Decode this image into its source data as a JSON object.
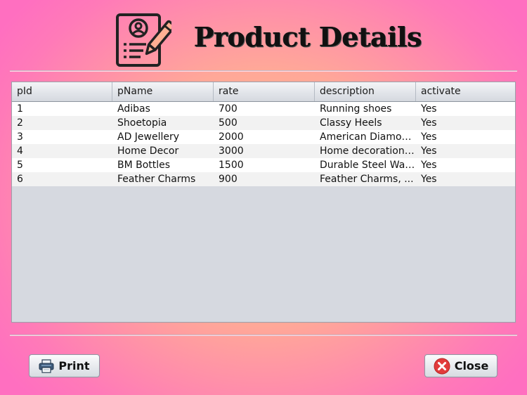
{
  "header": {
    "title": "Product Details",
    "icon": "product-details-icon"
  },
  "table": {
    "columns": [
      "pId",
      "pName",
      "rate",
      "description",
      "activate"
    ],
    "rows": [
      [
        "1",
        "Adibas",
        "700",
        "Running shoes",
        "Yes"
      ],
      [
        "2",
        "Shoetopia",
        "500",
        "Classy Heels",
        "Yes"
      ],
      [
        "3",
        "AD Jewellery",
        "2000",
        "American Diamond...",
        "Yes"
      ],
      [
        "4",
        "Home Decor",
        "3000",
        "Home decoration p...",
        "Yes"
      ],
      [
        "5",
        "BM Bottles",
        "1500",
        "Durable Steel Wat...",
        "Yes"
      ],
      [
        "6",
        "Feather Charms",
        "900",
        "Feather Charms, ...",
        "Yes"
      ]
    ]
  },
  "buttons": {
    "print_label": "Print",
    "print_icon": "printer-icon",
    "close_label": "Close",
    "close_icon": "close-icon"
  }
}
